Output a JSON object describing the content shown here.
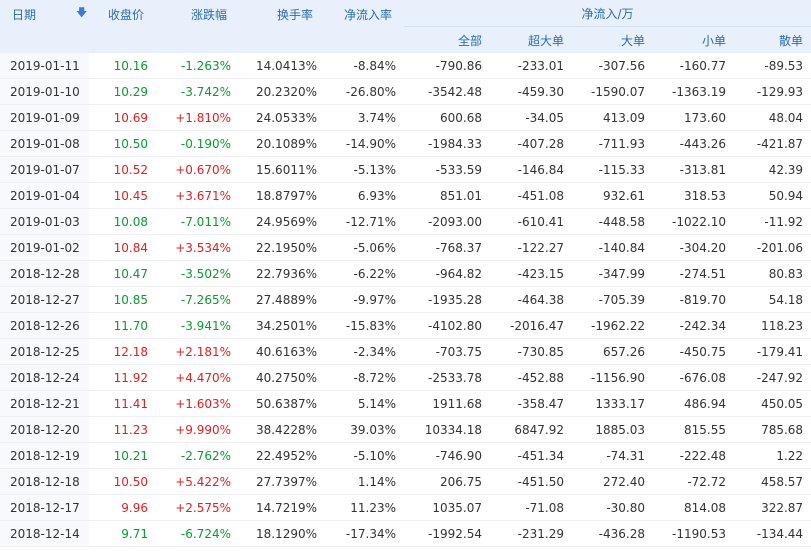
{
  "colors": {
    "up": "#e02020",
    "down": "#0a9b2e",
    "header_bg": "#e8f1fb",
    "header_text": "#2a6cb0"
  },
  "headers": {
    "date": "日期",
    "price": "收盘价",
    "change": "涨跌幅",
    "turnover": "换手率",
    "net_ratio": "净流入率",
    "net_group": "净流入/万",
    "all": "全部",
    "xl": "超大单",
    "l": "大单",
    "m": "小单",
    "s": "散单"
  },
  "sort_icon": "sort-down-arrow-icon",
  "rows": [
    {
      "date": "2019-01-11",
      "price": "10.16",
      "chg": "-1.263%",
      "turn": "14.0413%",
      "ratio": "-8.84%",
      "all": "-790.86",
      "xl": "-233.01",
      "l": "-307.56",
      "m": "-160.77",
      "s": "-89.53",
      "dir": "down"
    },
    {
      "date": "2019-01-10",
      "price": "10.29",
      "chg": "-3.742%",
      "turn": "20.2320%",
      "ratio": "-26.80%",
      "all": "-3542.48",
      "xl": "-459.30",
      "l": "-1590.07",
      "m": "-1363.19",
      "s": "-129.93",
      "dir": "down"
    },
    {
      "date": "2019-01-09",
      "price": "10.69",
      "chg": "+1.810%",
      "turn": "24.0533%",
      "ratio": "3.74%",
      "all": "600.68",
      "xl": "-34.05",
      "l": "413.09",
      "m": "173.60",
      "s": "48.04",
      "dir": "up"
    },
    {
      "date": "2019-01-08",
      "price": "10.50",
      "chg": "-0.190%",
      "turn": "20.1089%",
      "ratio": "-14.90%",
      "all": "-1984.33",
      "xl": "-407.28",
      "l": "-711.93",
      "m": "-443.26",
      "s": "-421.87",
      "dir": "down"
    },
    {
      "date": "2019-01-07",
      "price": "10.52",
      "chg": "+0.670%",
      "turn": "15.6011%",
      "ratio": "-5.13%",
      "all": "-533.59",
      "xl": "-146.84",
      "l": "-115.33",
      "m": "-313.81",
      "s": "42.39",
      "dir": "up"
    },
    {
      "date": "2019-01-04",
      "price": "10.45",
      "chg": "+3.671%",
      "turn": "18.8797%",
      "ratio": "6.93%",
      "all": "851.01",
      "xl": "-451.08",
      "l": "932.61",
      "m": "318.53",
      "s": "50.94",
      "dir": "up"
    },
    {
      "date": "2019-01-03",
      "price": "10.08",
      "chg": "-7.011%",
      "turn": "24.9569%",
      "ratio": "-12.71%",
      "all": "-2093.00",
      "xl": "-610.41",
      "l": "-448.58",
      "m": "-1022.10",
      "s": "-11.92",
      "dir": "down"
    },
    {
      "date": "2019-01-02",
      "price": "10.84",
      "chg": "+3.534%",
      "turn": "22.1950%",
      "ratio": "-5.06%",
      "all": "-768.37",
      "xl": "-122.27",
      "l": "-140.84",
      "m": "-304.20",
      "s": "-201.06",
      "dir": "up"
    },
    {
      "date": "2018-12-28",
      "price": "10.47",
      "chg": "-3.502%",
      "turn": "22.7936%",
      "ratio": "-6.22%",
      "all": "-964.82",
      "xl": "-423.15",
      "l": "-347.99",
      "m": "-274.51",
      "s": "80.83",
      "dir": "down"
    },
    {
      "date": "2018-12-27",
      "price": "10.85",
      "chg": "-7.265%",
      "turn": "27.4889%",
      "ratio": "-9.97%",
      "all": "-1935.28",
      "xl": "-464.38",
      "l": "-705.39",
      "m": "-819.70",
      "s": "54.18",
      "dir": "down"
    },
    {
      "date": "2018-12-26",
      "price": "11.70",
      "chg": "-3.941%",
      "turn": "34.2501%",
      "ratio": "-15.83%",
      "all": "-4102.80",
      "xl": "-2016.47",
      "l": "-1962.22",
      "m": "-242.34",
      "s": "118.23",
      "dir": "down"
    },
    {
      "date": "2018-12-25",
      "price": "12.18",
      "chg": "+2.181%",
      "turn": "40.6163%",
      "ratio": "-2.34%",
      "all": "-703.75",
      "xl": "-730.85",
      "l": "657.26",
      "m": "-450.75",
      "s": "-179.41",
      "dir": "up"
    },
    {
      "date": "2018-12-24",
      "price": "11.92",
      "chg": "+4.470%",
      "turn": "40.2750%",
      "ratio": "-8.72%",
      "all": "-2533.78",
      "xl": "-452.88",
      "l": "-1156.90",
      "m": "-676.08",
      "s": "-247.92",
      "dir": "up"
    },
    {
      "date": "2018-12-21",
      "price": "11.41",
      "chg": "+1.603%",
      "turn": "50.6387%",
      "ratio": "5.14%",
      "all": "1911.68",
      "xl": "-358.47",
      "l": "1333.17",
      "m": "486.94",
      "s": "450.05",
      "dir": "up"
    },
    {
      "date": "2018-12-20",
      "price": "11.23",
      "chg": "+9.990%",
      "turn": "38.4228%",
      "ratio": "39.03%",
      "all": "10334.18",
      "xl": "6847.92",
      "l": "1885.03",
      "m": "815.55",
      "s": "785.68",
      "dir": "up"
    },
    {
      "date": "2018-12-19",
      "price": "10.21",
      "chg": "-2.762%",
      "turn": "22.4952%",
      "ratio": "-5.10%",
      "all": "-746.90",
      "xl": "-451.34",
      "l": "-74.31",
      "m": "-222.48",
      "s": "1.22",
      "dir": "down"
    },
    {
      "date": "2018-12-18",
      "price": "10.50",
      "chg": "+5.422%",
      "turn": "27.7397%",
      "ratio": "1.14%",
      "all": "206.75",
      "xl": "-451.50",
      "l": "272.40",
      "m": "-72.72",
      "s": "458.57",
      "dir": "up"
    },
    {
      "date": "2018-12-17",
      "price": "9.96",
      "chg": "+2.575%",
      "turn": "14.7219%",
      "ratio": "11.23%",
      "all": "1035.07",
      "xl": "-71.08",
      "l": "-30.80",
      "m": "814.08",
      "s": "322.87",
      "dir": "up"
    },
    {
      "date": "2018-12-14",
      "price": "9.71",
      "chg": "-6.724%",
      "turn": "18.1290%",
      "ratio": "-17.34%",
      "all": "-1992.54",
      "xl": "-231.29",
      "l": "-436.28",
      "m": "-1190.53",
      "s": "-134.44",
      "dir": "down"
    }
  ]
}
